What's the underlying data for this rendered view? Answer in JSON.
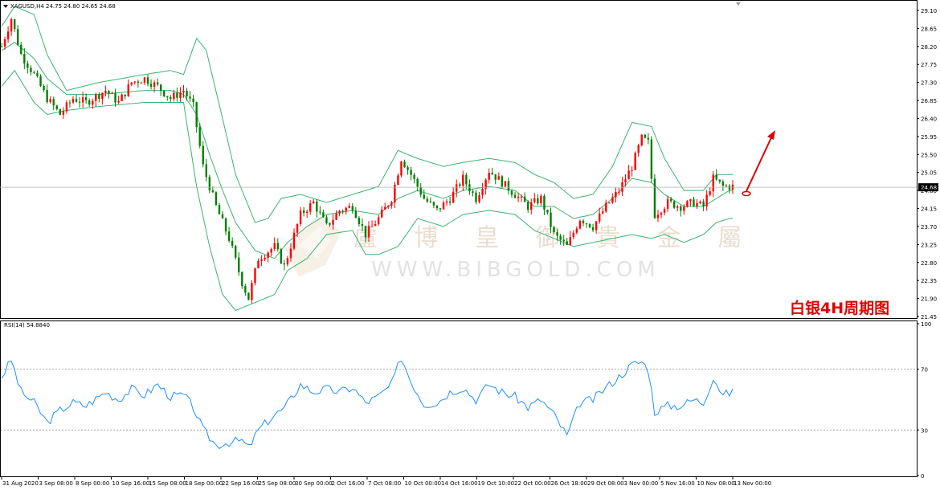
{
  "header": {
    "symbol_line": "XAGUSD,H4  24.75 24.80 24.65 24.68",
    "rsi_label": "RSI(14) 54.8840"
  },
  "watermark": {
    "text": "盧 博 皇 御 貴 金 屬",
    "url": "WWW.BIBGOLD.COM"
  },
  "annotation": "白银4H周期图",
  "colors": {
    "bull": "#ff0000",
    "bear": "#008000",
    "bands": "#3cb371",
    "rsi": "#1e90ff",
    "arrow": "#e00000",
    "price_line": "#b0b0b0",
    "grid_frame": "#000000"
  },
  "chart_data": [
    {
      "type": "candlestick",
      "symbol": "XAGUSD",
      "timeframe": "H4",
      "last_price": "24.68",
      "ylim": [
        21.45,
        29.25
      ],
      "yticks": [
        "29.10",
        "28.65",
        "28.20",
        "27.75",
        "27.30",
        "26.85",
        "26.40",
        "25.95",
        "25.50",
        "25.05",
        "24.60",
        "24.15",
        "23.70",
        "23.25",
        "22.80",
        "22.35",
        "21.90",
        "21.45"
      ],
      "xticks": [
        "31 Aug 2020",
        "3 Sep 08:00",
        "8 Sep 00:00",
        "10 Sep 16:00",
        "15 Sep 08:00",
        "18 Sep 00:00",
        "22 Sep 16:00",
        "25 Sep 08:00",
        "30 Sep 00:00",
        "2 Oct 16:00",
        "7 Oct 08:00",
        "10 Oct 00:00",
        "14 Oct 16:00",
        "19 Oct 10:00",
        "22 Oct 00:00",
        "26 Oct 18:00",
        "29 Oct 08:00",
        "3 Nov 00:00",
        "5 Nov 16:00",
        "10 Nov 08:00",
        "13 Nov 00:00"
      ],
      "anchors": [
        [
          0,
          28.2
        ],
        [
          3,
          28.9
        ],
        [
          6,
          28.0
        ],
        [
          10,
          27.5
        ],
        [
          14,
          26.9
        ],
        [
          18,
          26.5
        ],
        [
          22,
          26.9
        ],
        [
          26,
          26.8
        ],
        [
          32,
          27.1
        ],
        [
          36,
          26.8
        ],
        [
          40,
          27.3
        ],
        [
          44,
          27.4
        ],
        [
          48,
          27.2
        ],
        [
          52,
          26.9
        ],
        [
          56,
          27.1
        ],
        [
          59,
          26.7
        ],
        [
          62,
          25.2
        ],
        [
          66,
          24.2
        ],
        [
          70,
          23.4
        ],
        [
          74,
          22.3
        ],
        [
          76,
          21.9
        ],
        [
          79,
          22.9
        ],
        [
          84,
          23.2
        ],
        [
          87,
          22.7
        ],
        [
          92,
          24.0
        ],
        [
          96,
          24.3
        ],
        [
          100,
          23.7
        ],
        [
          104,
          24.1
        ],
        [
          108,
          24.2
        ],
        [
          112,
          23.5
        ],
        [
          116,
          23.9
        ],
        [
          120,
          24.4
        ],
        [
          123,
          25.4
        ],
        [
          126,
          25.0
        ],
        [
          130,
          24.4
        ],
        [
          134,
          24.1
        ],
        [
          138,
          24.4
        ],
        [
          142,
          24.9
        ],
        [
          146,
          24.4
        ],
        [
          150,
          25.1
        ],
        [
          154,
          24.8
        ],
        [
          158,
          24.5
        ],
        [
          162,
          24.2
        ],
        [
          166,
          24.4
        ],
        [
          170,
          23.5
        ],
        [
          174,
          23.2
        ],
        [
          178,
          23.9
        ],
        [
          182,
          23.7
        ],
        [
          186,
          24.2
        ],
        [
          190,
          24.6
        ],
        [
          194,
          25.2
        ],
        [
          197,
          25.9
        ],
        [
          199,
          25.8
        ],
        [
          201,
          24.0
        ],
        [
          205,
          24.3
        ],
        [
          209,
          24.2
        ],
        [
          213,
          24.3
        ],
        [
          216,
          24.2
        ],
        [
          219,
          24.9
        ],
        [
          222,
          24.7
        ],
        [
          225,
          24.7
        ]
      ],
      "bollinger": {
        "upper": [
          [
            0,
            28.7
          ],
          [
            4,
            29.2
          ],
          [
            10,
            29.0
          ],
          [
            14,
            28.0
          ],
          [
            20,
            27.1
          ],
          [
            30,
            27.3
          ],
          [
            44,
            27.5
          ],
          [
            52,
            27.6
          ],
          [
            56,
            27.5
          ],
          [
            60,
            28.4
          ],
          [
            63,
            28.1
          ],
          [
            68,
            26.4
          ],
          [
            72,
            25.0
          ],
          [
            78,
            23.8
          ],
          [
            82,
            23.9
          ],
          [
            86,
            24.4
          ],
          [
            92,
            24.5
          ],
          [
            100,
            24.3
          ],
          [
            108,
            24.5
          ],
          [
            116,
            24.7
          ],
          [
            122,
            25.6
          ],
          [
            128,
            25.4
          ],
          [
            136,
            25.2
          ],
          [
            142,
            25.3
          ],
          [
            150,
            25.4
          ],
          [
            158,
            25.3
          ],
          [
            164,
            25.0
          ],
          [
            170,
            24.8
          ],
          [
            176,
            24.4
          ],
          [
            182,
            24.5
          ],
          [
            188,
            25.2
          ],
          [
            194,
            26.3
          ],
          [
            200,
            26.2
          ],
          [
            204,
            25.4
          ],
          [
            210,
            24.6
          ],
          [
            216,
            24.6
          ],
          [
            220,
            25.0
          ],
          [
            224,
            25.0
          ]
        ],
        "middle": [
          [
            0,
            28.1
          ],
          [
            4,
            28.3
          ],
          [
            10,
            27.9
          ],
          [
            14,
            27.4
          ],
          [
            20,
            27.0
          ],
          [
            30,
            27.0
          ],
          [
            44,
            27.1
          ],
          [
            52,
            27.1
          ],
          [
            56,
            27.0
          ],
          [
            60,
            26.5
          ],
          [
            64,
            25.5
          ],
          [
            68,
            24.6
          ],
          [
            72,
            23.8
          ],
          [
            78,
            23.1
          ],
          [
            84,
            22.9
          ],
          [
            88,
            23.3
          ],
          [
            94,
            23.7
          ],
          [
            100,
            24.0
          ],
          [
            108,
            24.1
          ],
          [
            116,
            24.0
          ],
          [
            122,
            24.4
          ],
          [
            128,
            24.6
          ],
          [
            136,
            24.4
          ],
          [
            142,
            24.6
          ],
          [
            150,
            24.7
          ],
          [
            158,
            24.6
          ],
          [
            164,
            24.2
          ],
          [
            170,
            24.2
          ],
          [
            176,
            23.9
          ],
          [
            182,
            24.0
          ],
          [
            188,
            24.4
          ],
          [
            194,
            24.9
          ],
          [
            200,
            24.8
          ],
          [
            204,
            24.5
          ],
          [
            210,
            24.2
          ],
          [
            216,
            24.2
          ],
          [
            220,
            24.4
          ],
          [
            224,
            24.6
          ]
        ],
        "lower": [
          [
            0,
            27.2
          ],
          [
            4,
            27.6
          ],
          [
            10,
            26.8
          ],
          [
            14,
            26.5
          ],
          [
            20,
            26.6
          ],
          [
            30,
            26.7
          ],
          [
            44,
            26.8
          ],
          [
            52,
            26.8
          ],
          [
            56,
            26.8
          ],
          [
            60,
            24.7
          ],
          [
            64,
            23.2
          ],
          [
            68,
            22.0
          ],
          [
            72,
            21.6
          ],
          [
            78,
            21.8
          ],
          [
            84,
            22.0
          ],
          [
            88,
            22.6
          ],
          [
            94,
            22.9
          ],
          [
            100,
            23.5
          ],
          [
            108,
            23.6
          ],
          [
            112,
            23.0
          ],
          [
            116,
            23.0
          ],
          [
            122,
            23.2
          ],
          [
            128,
            23.9
          ],
          [
            136,
            23.7
          ],
          [
            142,
            24.0
          ],
          [
            150,
            24.1
          ],
          [
            158,
            24.0
          ],
          [
            164,
            23.6
          ],
          [
            170,
            23.4
          ],
          [
            176,
            23.2
          ],
          [
            182,
            23.3
          ],
          [
            188,
            23.4
          ],
          [
            194,
            23.5
          ],
          [
            200,
            23.4
          ],
          [
            204,
            23.5
          ],
          [
            210,
            23.3
          ],
          [
            216,
            23.5
          ],
          [
            220,
            23.8
          ],
          [
            224,
            23.9
          ]
        ]
      }
    },
    {
      "type": "line",
      "indicator": "RSI(14)",
      "value": "54.8840",
      "ylim": [
        0,
        100
      ],
      "yticks": [
        "100",
        "70",
        "30",
        "0"
      ],
      "levels": [
        70,
        30
      ],
      "x": [
        0,
        3,
        6,
        10,
        14,
        18,
        22,
        26,
        32,
        36,
        40,
        44,
        48,
        52,
        56,
        59,
        62,
        66,
        70,
        74,
        76,
        79,
        84,
        87,
        92,
        96,
        100,
        104,
        108,
        112,
        116,
        120,
        123,
        126,
        130,
        134,
        138,
        142,
        146,
        150,
        154,
        158,
        162,
        166,
        170,
        174,
        178,
        182,
        186,
        190,
        194,
        197,
        199,
        201,
        205,
        209,
        213,
        216,
        219,
        222,
        225
      ],
      "values": [
        65,
        76,
        55,
        48,
        35,
        43,
        48,
        46,
        55,
        50,
        57,
        53,
        60,
        52,
        53,
        45,
        30,
        20,
        22,
        23,
        18,
        30,
        40,
        44,
        60,
        55,
        57,
        55,
        58,
        48,
        52,
        60,
        78,
        62,
        47,
        48,
        55,
        58,
        50,
        60,
        55,
        52,
        45,
        50,
        40,
        26,
        48,
        50,
        58,
        65,
        73,
        75,
        70,
        42,
        46,
        46,
        50,
        48,
        65,
        53,
        55
      ]
    }
  ]
}
